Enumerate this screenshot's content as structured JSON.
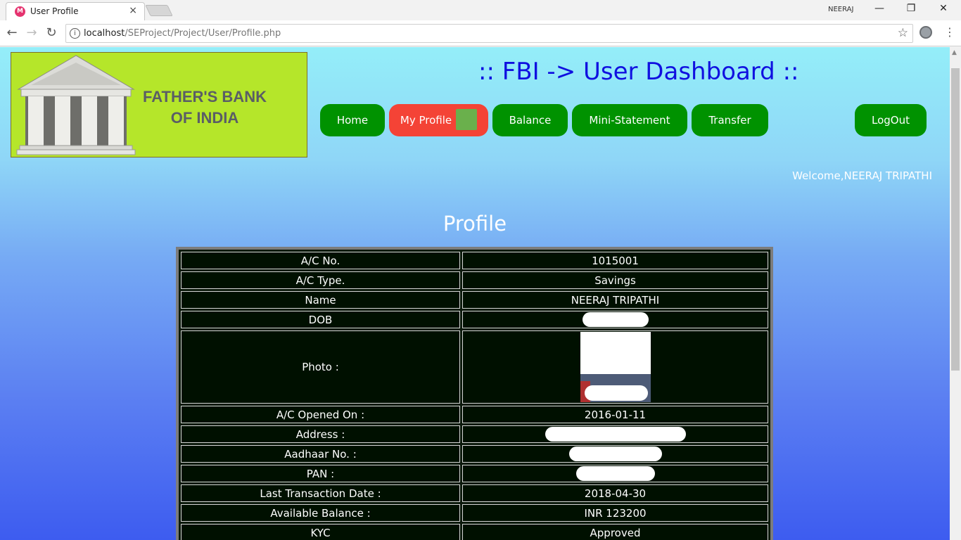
{
  "browser": {
    "tab_title": "User Profile",
    "tab_favicon": "M",
    "tab_close": "×",
    "profile_name": "NEERAJ",
    "url_host": "localhost",
    "url_path": "/SEProject/Project/User/Profile.php",
    "win_minimize": "—",
    "win_restore": "❐",
    "win_close": "✕"
  },
  "logo": {
    "line1": "FATHER'S BANK",
    "line2": "OF INDIA"
  },
  "header": {
    "title": ":: FBI -> User Dashboard ::",
    "welcome": "Welcome,NEERAJ TRIPATHI"
  },
  "nav": {
    "home": "Home",
    "profile": "My Profile",
    "balance": "Balance",
    "statement": "Mini-Statement",
    "transfer": "Transfer",
    "logout": "LogOut"
  },
  "profile": {
    "heading": "Profile",
    "rows": [
      {
        "label": "A/C No.",
        "value": "1015001"
      },
      {
        "label": "A/C Type.",
        "value": "Savings"
      },
      {
        "label": "Name",
        "value": "NEERAJ TRIPATHI"
      },
      {
        "label": "DOB",
        "value": ""
      },
      {
        "label": "Photo :",
        "value": ""
      },
      {
        "label": "A/C Opened On :",
        "value": "2016-01-11"
      },
      {
        "label": "Address :",
        "value": ""
      },
      {
        "label": "Aadhaar No. :",
        "value": ""
      },
      {
        "label": "PAN :",
        "value": ""
      },
      {
        "label": "Last Transaction Date :",
        "value": "2018-04-30"
      },
      {
        "label": "Available Balance :",
        "value": "INR 123200"
      },
      {
        "label": "KYC",
        "value": "Approved"
      }
    ]
  },
  "icons": {
    "back": "back-arrow-icon",
    "forward": "forward-arrow-icon",
    "reload": "reload-icon",
    "info": "info-icon",
    "star": "bookmark-star-icon",
    "menu": "kebab-menu-icon"
  },
  "colors": {
    "nav_green": "#009200",
    "nav_active": "#f44336",
    "title_blue": "#1010e0",
    "logo_bg": "#b5e62a"
  }
}
